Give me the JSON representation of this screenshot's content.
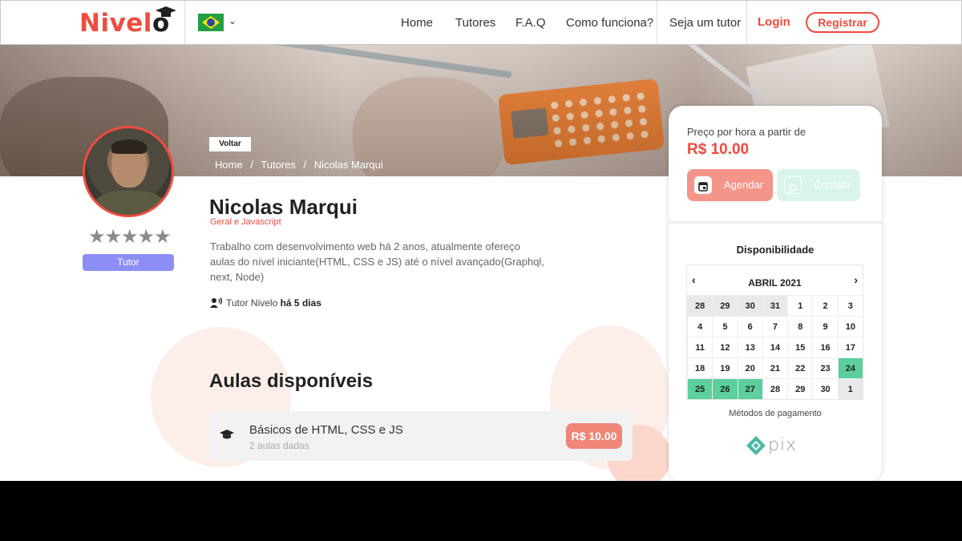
{
  "header": {
    "logo": {
      "pre": "Nivel",
      "o": "o"
    },
    "nav": [
      "Home",
      "Tutores",
      "F.A.Q",
      "Como funciona?",
      "Seja um tutor"
    ],
    "login": "Login",
    "register": "Registrar",
    "language_flag": "brazil-flag-icon"
  },
  "banner": {
    "back": "Voltar",
    "breadcrumb": [
      "Home",
      "/",
      "Tutores",
      "/",
      "Nicolas Marqui"
    ]
  },
  "tutor": {
    "name": "Nicolas Marqui",
    "subjects": "Geral e Javascript",
    "bio": "Trabalho com desenvolvimento web há 2 anos, atualmente ofereço aulas do nível iniciante(HTML, CSS e JS) até o nível avançado(Graphql, next, Node)",
    "stars": "★★★★★",
    "rating": 5,
    "badge": "Tutor",
    "since_label": "Tutor Nivelo",
    "since_value": "há 5 dias"
  },
  "aulas": {
    "title": "Aulas disponíveis",
    "items": [
      {
        "title": "Básicos de HTML, CSS e JS",
        "subtitle": "2 aulas dadas",
        "price": "R$ 10.00"
      }
    ]
  },
  "card": {
    "price_label": "Preço por hora a partir de",
    "price": "R$ 10.00",
    "agendar": "Agendar",
    "contato": "Contato",
    "availability_title": "Disponibilidade",
    "month": "ABRIL 2021",
    "payment_title": "Métodos de pagamento",
    "payment_logo_text": "pix",
    "accent": "#ef4b3f",
    "available_color": "#5ccf9c"
  },
  "calendar": {
    "days": [
      {
        "d": "28",
        "s": "muted"
      },
      {
        "d": "29",
        "s": "muted"
      },
      {
        "d": "30",
        "s": "muted"
      },
      {
        "d": "31",
        "s": "muted"
      },
      {
        "d": "1",
        "s": ""
      },
      {
        "d": "2",
        "s": ""
      },
      {
        "d": "3",
        "s": ""
      },
      {
        "d": "4",
        "s": ""
      },
      {
        "d": "5",
        "s": ""
      },
      {
        "d": "6",
        "s": ""
      },
      {
        "d": "7",
        "s": ""
      },
      {
        "d": "8",
        "s": ""
      },
      {
        "d": "9",
        "s": ""
      },
      {
        "d": "10",
        "s": ""
      },
      {
        "d": "11",
        "s": ""
      },
      {
        "d": "12",
        "s": ""
      },
      {
        "d": "13",
        "s": ""
      },
      {
        "d": "14",
        "s": ""
      },
      {
        "d": "15",
        "s": ""
      },
      {
        "d": "16",
        "s": ""
      },
      {
        "d": "17",
        "s": ""
      },
      {
        "d": "18",
        "s": ""
      },
      {
        "d": "19",
        "s": ""
      },
      {
        "d": "20",
        "s": ""
      },
      {
        "d": "21",
        "s": ""
      },
      {
        "d": "22",
        "s": ""
      },
      {
        "d": "23",
        "s": ""
      },
      {
        "d": "24",
        "s": "green"
      },
      {
        "d": "25",
        "s": "green"
      },
      {
        "d": "26",
        "s": "green"
      },
      {
        "d": "27",
        "s": "green"
      },
      {
        "d": "28",
        "s": ""
      },
      {
        "d": "29",
        "s": ""
      },
      {
        "d": "30",
        "s": ""
      },
      {
        "d": "1",
        "s": "muted"
      }
    ]
  }
}
